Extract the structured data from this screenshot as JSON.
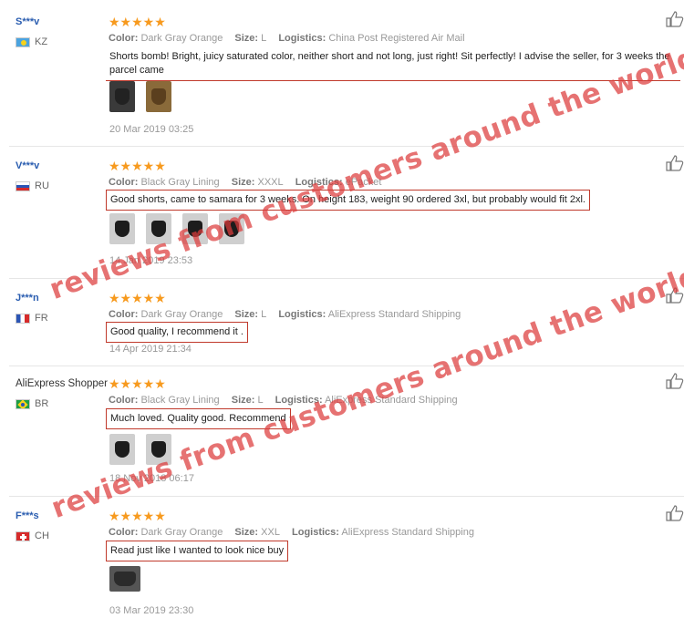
{
  "labels": {
    "color": "Color:",
    "size": "Size:",
    "logistics": "Logistics:"
  },
  "reviews": [
    {
      "buyer": "S***v",
      "country": "KZ",
      "stars": "★★★★★",
      "rating": 5,
      "color": "Dark Gray Orange",
      "size": "L",
      "logistics": "China Post Registered Air Mail",
      "text": "Shorts bomb! Bright, juicy saturated color, neither short and not long, just right! Sit perfectly! I advise the seller, for 3 weeks the parcel came",
      "date": "20 Mar 2019 03:25"
    },
    {
      "buyer": "V***v",
      "country": "RU",
      "stars": "★★★★★",
      "rating": 5,
      "color": "Black Gray Lining",
      "size": "XXXL",
      "logistics": "ePacket",
      "text": "Good shorts, came to samara for 3 weeks. On height 183, weight 90 ordered 3xl, but probably would fit 2xl.",
      "date": "14 Jan 2019 23:53"
    },
    {
      "buyer": "J***n",
      "country": "FR",
      "stars": "★★★★★",
      "rating": 5,
      "color": "Dark Gray Orange",
      "size": "L",
      "logistics": "AliExpress Standard Shipping",
      "text": "Good quality, I recommend it .",
      "date": "14 Apr 2019 21:34"
    },
    {
      "buyer": "AliExpress Shopper",
      "country": "BR",
      "stars": "★★★★★",
      "rating": 5,
      "color": "Black Gray Lining",
      "size": "L",
      "logistics": "AliExpress Standard Shipping",
      "text": "Much loved. Quality good. Recommend",
      "date": "18 Nov 2018 06:17"
    },
    {
      "buyer": "F***s",
      "country": "CH",
      "stars": "★★★★★",
      "rating": 5,
      "color": "Dark Gray Orange",
      "size": "XXL",
      "logistics": "AliExpress Standard Shipping",
      "text": "Read just like I wanted to look nice buy",
      "date": "03 Mar 2019 23:30"
    }
  ],
  "watermark": "reviews from customers around the world",
  "colors": {
    "accent_star": "#f79a1e",
    "buyer_link": "#2a5db0",
    "highlight_border": "#c0392b",
    "watermark": "#dc3c3c"
  }
}
